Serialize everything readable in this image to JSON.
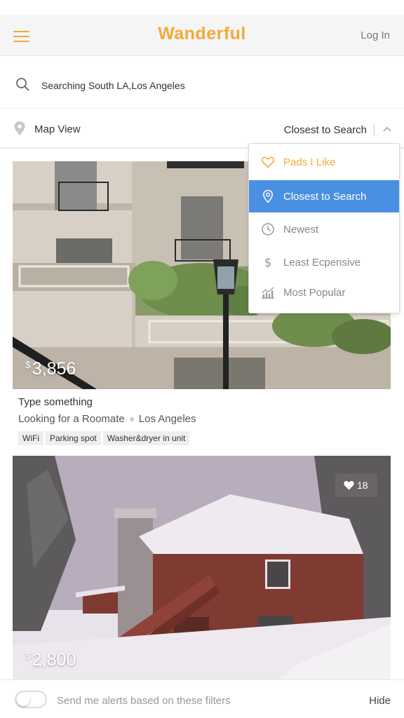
{
  "header": {
    "app_name": "Wanderful",
    "login_label": "Log In",
    "menu_icon": "hamburger-icon",
    "brand_color": "#f4a93a"
  },
  "search": {
    "value": "Searching South LA,Los Angeles",
    "icon": "search-icon"
  },
  "filter_bar": {
    "map_view_label": "Map View",
    "sort_selected": "Closest to Search",
    "map_icon": "location-pin-icon",
    "toggle_icon": "chevron-up-icon"
  },
  "sort_menu": {
    "accent_color": "#4a90e2",
    "items": [
      {
        "label": "Pads I Like",
        "icon": "heart-outline-icon",
        "state": "favorite"
      },
      {
        "label": "Closest to Search",
        "icon": "location-pin-icon",
        "state": "selected"
      },
      {
        "label": "Newest",
        "icon": "clock-icon",
        "state": "normal"
      },
      {
        "label": "Least Ecpensive",
        "icon": "dollar-icon",
        "state": "normal"
      },
      {
        "label": "Most Popular",
        "icon": "bar-chart-icon",
        "state": "normal"
      }
    ]
  },
  "listings": [
    {
      "currency": "$",
      "price": "3,856",
      "title": "Type something",
      "type": "Looking for a Roomate",
      "location": "Los Angeles",
      "amenities": [
        "WiFi",
        "Parking spot",
        "Washer&dryer in unit"
      ]
    },
    {
      "currency": "$",
      "price": "2,800",
      "likes": "18",
      "like_icon": "heart-icon"
    }
  ],
  "footer": {
    "alerts_label": "Send me alerts based on these filters",
    "alerts_enabled": false,
    "hide_label": "Hide"
  }
}
